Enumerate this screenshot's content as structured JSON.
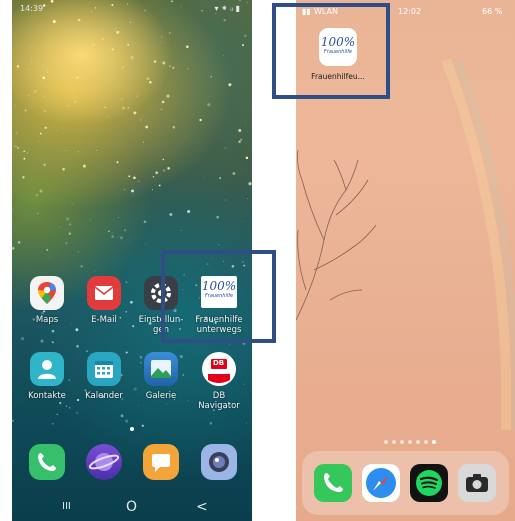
{
  "android": {
    "status": {
      "time": "14:39",
      "right": "▾ ⁕ ᵢₗ ▮"
    },
    "apps_row1": [
      {
        "label": "Maps",
        "icon": "maps-icon"
      },
      {
        "label": "E-Mail",
        "icon": "email-icon"
      },
      {
        "label": "Einstellun-\ngen",
        "icon": "settings-icon"
      },
      {
        "label": "Frauenhilfe\nunterwegs",
        "icon": "frauenhilfe-icon",
        "badge": "100%",
        "badge_sub": "Frauenhilfe"
      }
    ],
    "apps_row2": [
      {
        "label": "Kontakte",
        "icon": "contacts-icon"
      },
      {
        "label": "Kalender",
        "icon": "calendar-icon"
      },
      {
        "label": "Galerie",
        "icon": "gallery-icon"
      },
      {
        "label": "DB\nNavigator",
        "icon": "db-navigator-icon",
        "badge": "DB"
      }
    ],
    "dock": [
      {
        "icon": "phone-icon"
      },
      {
        "icon": "browser-icon"
      },
      {
        "icon": "messages-icon"
      },
      {
        "icon": "camera-icon"
      }
    ],
    "nav": {
      "recent": "III",
      "home": "O",
      "back": "<"
    }
  },
  "ios": {
    "status": {
      "carrier": "WLAN",
      "time": "12:02",
      "battery": "66 %"
    },
    "app": {
      "label": "Frauenhilfeu...",
      "badge": "100%",
      "badge_sub": "Frauenhilfe"
    },
    "dock": [
      {
        "icon": "phone-icon"
      },
      {
        "icon": "safari-icon"
      },
      {
        "icon": "spotify-icon"
      },
      {
        "icon": "camera-icon"
      }
    ]
  },
  "colors": {
    "highlight": "#2f4d86",
    "ios_bg": "#eab595"
  }
}
